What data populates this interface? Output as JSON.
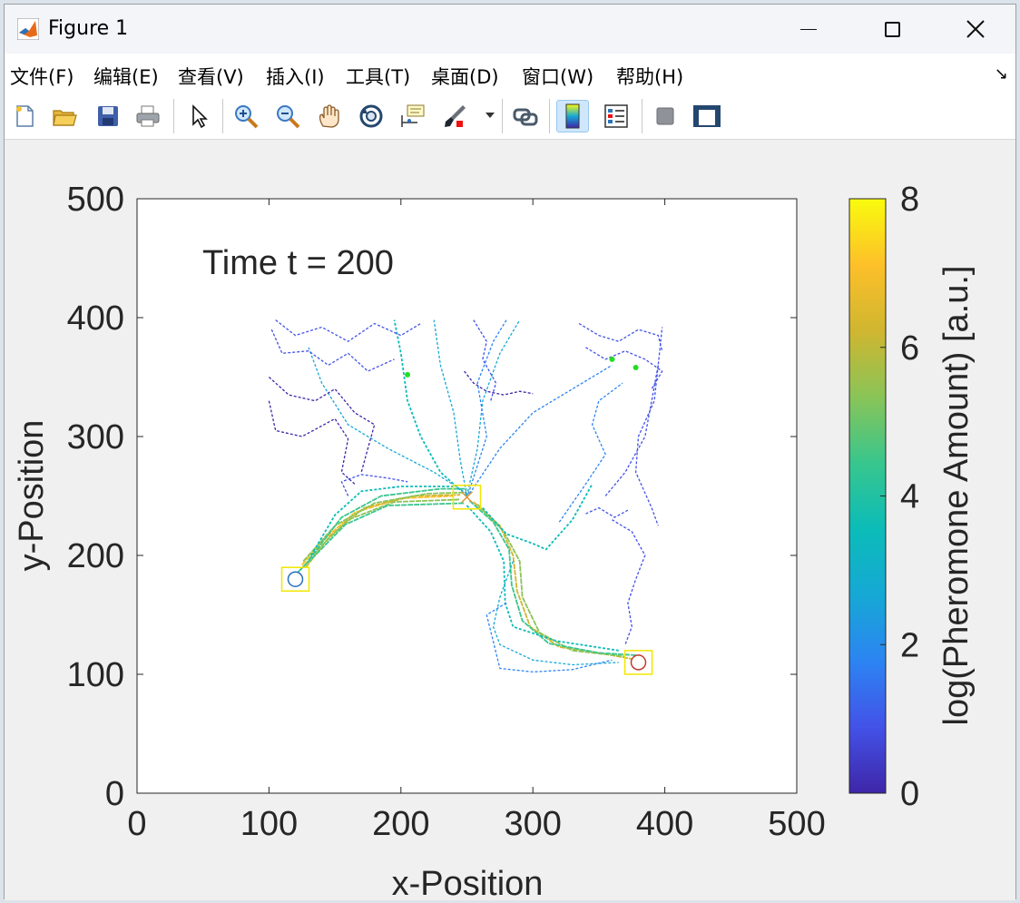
{
  "window": {
    "title": "Figure 1",
    "controls": {
      "minimize": "—",
      "maximize": "☐",
      "close": "✕"
    }
  },
  "menu": {
    "items": [
      "文件(F)",
      "编辑(E)",
      "查看(V)",
      "插入(I)",
      "工具(T)",
      "桌面(D)",
      "窗口(W)",
      "帮助(H)"
    ],
    "extra": "↘"
  },
  "toolbar": {
    "icons": [
      "new-figure-icon",
      "open-file-icon",
      "save-icon",
      "print-icon",
      "select-arrow-icon",
      "zoom-in-icon",
      "zoom-out-icon",
      "pan-hand-icon",
      "rotate-3d-icon",
      "data-cursor-icon",
      "brush-icon",
      "brush-dropdown-icon",
      "link-plot-icon",
      "colorbar-icon",
      "legend-icon",
      "hide-plot-tools-icon",
      "show-plot-tools-icon"
    ]
  },
  "chart_data": {
    "type": "scatter",
    "annotation": "Time t = 200",
    "xlabel": "x-Position",
    "ylabel": "y-Position",
    "xlim": [
      0,
      500
    ],
    "ylim": [
      0,
      500
    ],
    "xticks": [
      "0",
      "100",
      "200",
      "300",
      "400",
      "500"
    ],
    "yticks": [
      "0",
      "100",
      "200",
      "300",
      "400",
      "500"
    ],
    "colorbar": {
      "label": "log(Pheromone Amount) [a.u.]",
      "ticks": [
        "0",
        "2",
        "4",
        "6",
        "8"
      ],
      "range": [
        0,
        8
      ],
      "colormap": "parula",
      "colors": [
        "#3e26a8",
        "#4352e8",
        "#2c84f2",
        "#16a8d5",
        "#0bbcb8",
        "#38c68d",
        "#8ac457",
        "#d0b630",
        "#fdc029",
        "#f9fb0e"
      ]
    },
    "markers": [
      {
        "name": "nest",
        "shape": "circle",
        "x": 120,
        "y": 180,
        "color": "#2a6fbd"
      },
      {
        "name": "food-center",
        "shape": "x",
        "x": 250,
        "y": 249,
        "color": "#e09a3a"
      },
      {
        "name": "food-right",
        "shape": "circle",
        "x": 380,
        "y": 110,
        "color": "#c0392b"
      }
    ],
    "highlight_boxes": [
      {
        "x": 120,
        "y": 180
      },
      {
        "x": 250,
        "y": 249
      },
      {
        "x": 380,
        "y": 110
      }
    ],
    "green_dots": [
      {
        "x": 205,
        "y": 352
      },
      {
        "x": 360,
        "y": 365
      },
      {
        "x": 378,
        "y": 358
      }
    ],
    "trails": [
      {
        "level": 7.0,
        "points": [
          [
            125,
            192
          ],
          [
            140,
            212
          ],
          [
            165,
            236
          ],
          [
            200,
            248
          ],
          [
            240,
            250
          ]
        ]
      },
      {
        "level": 6.2,
        "points": [
          [
            128,
            190
          ],
          [
            146,
            216
          ],
          [
            172,
            240
          ],
          [
            210,
            250
          ],
          [
            245,
            251
          ]
        ]
      },
      {
        "level": 5.6,
        "points": [
          [
            124,
            188
          ],
          [
            138,
            206
          ],
          [
            160,
            230
          ],
          [
            195,
            245
          ],
          [
            245,
            247
          ]
        ]
      },
      {
        "level": 5.0,
        "points": [
          [
            126,
            195
          ],
          [
            150,
            225
          ],
          [
            180,
            244
          ],
          [
            220,
            252
          ],
          [
            250,
            253
          ]
        ]
      },
      {
        "level": 4.6,
        "points": [
          [
            122,
            186
          ],
          [
            135,
            200
          ],
          [
            158,
            226
          ],
          [
            190,
            242
          ],
          [
            248,
            244
          ]
        ]
      },
      {
        "level": 4.2,
        "points": [
          [
            130,
            196
          ],
          [
            155,
            232
          ],
          [
            185,
            250
          ],
          [
            230,
            256
          ],
          [
            250,
            256
          ]
        ]
      },
      {
        "level": 3.8,
        "points": [
          [
            132,
            200
          ],
          [
            150,
            234
          ],
          [
            170,
            254
          ],
          [
            200,
            258
          ],
          [
            240,
            258
          ]
        ]
      },
      {
        "level": 5.8,
        "points": [
          [
            255,
            245
          ],
          [
            275,
            225
          ],
          [
            285,
            200
          ],
          [
            288,
            170
          ],
          [
            298,
            140
          ],
          [
            320,
            123
          ],
          [
            360,
            116
          ],
          [
            375,
            113
          ]
        ]
      },
      {
        "level": 5.0,
        "points": [
          [
            258,
            243
          ],
          [
            278,
            220
          ],
          [
            290,
            195
          ],
          [
            292,
            165
          ],
          [
            305,
            135
          ],
          [
            330,
            120
          ],
          [
            370,
            115
          ]
        ]
      },
      {
        "level": 4.4,
        "points": [
          [
            252,
            246
          ],
          [
            270,
            228
          ],
          [
            282,
            205
          ],
          [
            284,
            175
          ],
          [
            292,
            145
          ],
          [
            312,
            126
          ],
          [
            350,
            118
          ],
          [
            378,
            116
          ]
        ]
      },
      {
        "level": 3.6,
        "points": [
          [
            250,
            242
          ],
          [
            268,
            220
          ],
          [
            278,
            195
          ],
          [
            279,
            160
          ],
          [
            285,
            140
          ],
          [
            318,
            128
          ],
          [
            365,
            120
          ]
        ]
      },
      {
        "level": 3.2,
        "points": [
          [
            262,
            240
          ],
          [
            280,
            218
          ],
          [
            300,
            210
          ],
          [
            310,
            205
          ],
          [
            330,
            230
          ],
          [
            345,
            260
          ]
        ]
      },
      {
        "level": 2.6,
        "points": [
          [
            285,
            195
          ],
          [
            275,
            165
          ],
          [
            270,
            140
          ],
          [
            275,
            125
          ],
          [
            300,
            112
          ],
          [
            330,
            108
          ],
          [
            365,
            110
          ]
        ]
      },
      {
        "level": 2.2,
        "points": [
          [
            280,
            160
          ],
          [
            265,
            150
          ],
          [
            275,
            105
          ],
          [
            300,
            102
          ],
          [
            330,
            104
          ],
          [
            360,
            112
          ]
        ]
      },
      {
        "level": 3.4,
        "points": [
          [
            250,
            250
          ],
          [
            230,
            270
          ],
          [
            215,
            300
          ],
          [
            205,
            330
          ],
          [
            200,
            370
          ],
          [
            195,
            398
          ]
        ]
      },
      {
        "level": 3.0,
        "points": [
          [
            250,
            250
          ],
          [
            245,
            280
          ],
          [
            240,
            320
          ],
          [
            230,
            360
          ],
          [
            225,
            398
          ]
        ]
      },
      {
        "level": 2.8,
        "points": [
          [
            250,
            250
          ],
          [
            258,
            290
          ],
          [
            262,
            330
          ],
          [
            275,
            370
          ],
          [
            290,
            398
          ]
        ]
      },
      {
        "level": 2.4,
        "points": [
          [
            250,
            252
          ],
          [
            225,
            270
          ],
          [
            190,
            290
          ],
          [
            160,
            310
          ],
          [
            140,
            345
          ],
          [
            130,
            375
          ]
        ]
      },
      {
        "level": 2.0,
        "points": [
          [
            252,
            252
          ],
          [
            275,
            290
          ],
          [
            300,
            320
          ],
          [
            330,
            340
          ],
          [
            360,
            360
          ]
        ]
      },
      {
        "level": 1.6,
        "points": [
          [
            250,
            248
          ],
          [
            265,
            300
          ],
          [
            258,
            345
          ],
          [
            270,
            380
          ],
          [
            280,
            398
          ]
        ]
      },
      {
        "level": 1.4,
        "points": [
          [
            320,
            228
          ],
          [
            340,
            260
          ],
          [
            355,
            285
          ],
          [
            345,
            310
          ],
          [
            350,
            330
          ],
          [
            368,
            345
          ]
        ]
      },
      {
        "level": 0.8,
        "points": [
          [
            355,
            250
          ],
          [
            370,
            270
          ],
          [
            385,
            300
          ],
          [
            390,
            330
          ],
          [
            395,
            360
          ],
          [
            398,
            392
          ]
        ]
      },
      {
        "level": 0.7,
        "points": [
          [
            395,
            360
          ],
          [
            392,
            330
          ],
          [
            380,
            300
          ],
          [
            378,
            270
          ],
          [
            390,
            240
          ],
          [
            395,
            225
          ]
        ]
      },
      {
        "level": 0.6,
        "points": [
          [
            360,
            230
          ],
          [
            375,
            220
          ],
          [
            385,
            200
          ],
          [
            378,
            180
          ],
          [
            372,
            160
          ],
          [
            375,
            140
          ],
          [
            370,
            125
          ]
        ]
      },
      {
        "level": 0.6,
        "points": [
          [
            340,
            235
          ],
          [
            350,
            240
          ],
          [
            362,
            232
          ],
          [
            372,
            238
          ]
        ]
      },
      {
        "level": 0.5,
        "points": [
          [
            105,
            398
          ],
          [
            120,
            385
          ],
          [
            140,
            392
          ],
          [
            160,
            380
          ],
          [
            180,
            395
          ],
          [
            200,
            385
          ],
          [
            215,
            395
          ]
        ]
      },
      {
        "level": 0.5,
        "points": [
          [
            102,
            390
          ],
          [
            110,
            370
          ],
          [
            130,
            372
          ],
          [
            145,
            360
          ],
          [
            160,
            370
          ],
          [
            175,
            355
          ],
          [
            195,
            365
          ]
        ]
      },
      {
        "level": 0.4,
        "points": [
          [
            100,
            350
          ],
          [
            115,
            335
          ],
          [
            135,
            330
          ],
          [
            150,
            340
          ],
          [
            165,
            320
          ],
          [
            180,
            310
          ],
          [
            175,
            290
          ],
          [
            170,
            270
          ]
        ]
      },
      {
        "level": 0.4,
        "points": [
          [
            100,
            330
          ],
          [
            105,
            305
          ],
          [
            125,
            300
          ],
          [
            150,
            315
          ],
          [
            160,
            298
          ],
          [
            155,
            270
          ],
          [
            165,
            260
          ]
        ]
      },
      {
        "level": 0.5,
        "points": [
          [
            335,
            395
          ],
          [
            350,
            385
          ],
          [
            365,
            380
          ],
          [
            380,
            390
          ],
          [
            395,
            385
          ],
          [
            398,
            372
          ]
        ]
      },
      {
        "level": 0.5,
        "points": [
          [
            340,
            375
          ],
          [
            355,
            365
          ],
          [
            370,
            372
          ],
          [
            385,
            365
          ],
          [
            398,
            355
          ],
          [
            390,
            340
          ]
        ]
      },
      {
        "level": 0.5,
        "points": [
          [
            255,
            398
          ],
          [
            265,
            380
          ],
          [
            262,
            365
          ],
          [
            272,
            345
          ],
          [
            268,
            330
          ]
        ]
      },
      {
        "level": 0.4,
        "points": [
          [
            248,
            355
          ],
          [
            255,
            345
          ],
          [
            265,
            338
          ],
          [
            278,
            335
          ],
          [
            290,
            338
          ],
          [
            300,
            336
          ]
        ]
      },
      {
        "level": 1.0,
        "points": [
          [
            160,
            250
          ],
          [
            155,
            262
          ],
          [
            170,
            268
          ],
          [
            190,
            265
          ],
          [
            205,
            262
          ]
        ]
      }
    ]
  }
}
